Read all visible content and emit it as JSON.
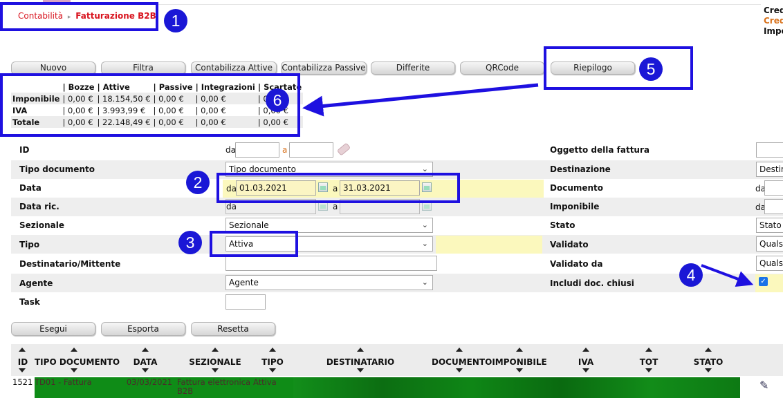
{
  "breadcrumb": {
    "section": "Contabilità",
    "separator": "▸",
    "page": "Fatturazione B2B"
  },
  "right_info": {
    "line1": "Cred",
    "line2": "Cred",
    "line3": "Impo"
  },
  "markers": [
    "1",
    "2",
    "3",
    "4",
    "5",
    "6"
  ],
  "toolbar": {
    "nuovo": "Nuovo",
    "filtra": "Filtra",
    "contabilizza_attive": "Contabilizza Attive",
    "contabilizza_passive": "Contabilizza Passive",
    "differite": "Differite",
    "qrcode": "QRCode",
    "riepilogo": "Riepilogo"
  },
  "summary": {
    "headers": [
      "| Bozze",
      "| Attive",
      "| Passive",
      "| Integrazioni",
      "| Scartate"
    ],
    "rows": [
      {
        "label": "Imponibile",
        "values": [
          "| 0,00 €",
          "| 18.154,50 €",
          "| 0,00 €",
          "| 0,00 €",
          "| 0,00 €"
        ]
      },
      {
        "label": "IVA",
        "values": [
          "| 0,00 €",
          "| 3.993,99 €",
          "| 0,00 €",
          "| 0,00 €",
          "| 0,00 €"
        ]
      },
      {
        "label": "Totale",
        "values": [
          "| 0,00 €",
          "| 22.148,49 €",
          "| 0,00 €",
          "| 0,00 €",
          "| 0,00 €"
        ]
      }
    ]
  },
  "filters": {
    "id": {
      "label": "ID",
      "from": "da",
      "to": "a"
    },
    "tipo_documento": {
      "label": "Tipo documento",
      "value": "Tipo documento"
    },
    "data": {
      "label": "Data",
      "from_label": "da",
      "from_value": "01.03.2021",
      "to_label": "a",
      "to_value": "31.03.2021"
    },
    "data_ric": {
      "label": "Data ric.",
      "from_label": "da",
      "to_label": "a"
    },
    "sezionale": {
      "label": "Sezionale",
      "value": "Sezionale"
    },
    "tipo": {
      "label": "Tipo",
      "value": "Attiva"
    },
    "destinatario": {
      "label": "Destinatario/Mittente"
    },
    "agente": {
      "label": "Agente",
      "value": "Agente"
    },
    "task": {
      "label": "Task"
    },
    "oggetto": {
      "label": "Oggetto della fattura"
    },
    "destinazione": {
      "label": "Destinazione",
      "value": "Destin"
    },
    "documento": {
      "label": "Documento",
      "prefix": "da"
    },
    "imponibile": {
      "label": "Imponibile",
      "prefix": "da"
    },
    "stato": {
      "label": "Stato",
      "value": "Stato"
    },
    "validato": {
      "label": "Validato",
      "value": "Qualsi"
    },
    "validato_da": {
      "label": "Validato da",
      "value": "Qualsi"
    },
    "includi_chiusi": {
      "label": "Includi doc. chiusi",
      "checked": true
    }
  },
  "actions": {
    "esegui": "Esegui",
    "esporta": "Esporta",
    "resetta": "Resetta"
  },
  "table": {
    "columns": [
      "ID",
      "TIPO DOCUMENTO",
      "DATA",
      "SEZIONALE",
      "TIPO",
      "DESTINATARIO",
      "DOCUMENTO",
      "IMPONIBILE",
      "IVA",
      "TOT",
      "STATO"
    ],
    "rows": [
      {
        "id": "1521",
        "tipo_documento": "TD01 - Fattura",
        "data": "03/03/2021",
        "sezionale": "Fattura elettronica B2B",
        "tipo": "Attiva"
      }
    ]
  },
  "colors": {
    "accent_red": "#d8131e",
    "annotation_blue": "#1e10e0",
    "row_green": "#0f8c17",
    "highlight_yellow": "#fbf8bd"
  }
}
